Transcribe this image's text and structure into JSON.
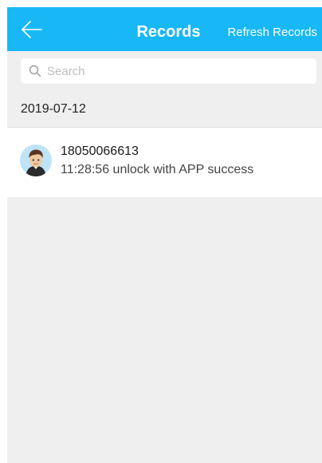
{
  "navbar": {
    "title": "Records",
    "refresh_label": "Refresh Records",
    "bg_color": "#18b8f7",
    "back_icon": "arrow-left-icon"
  },
  "search": {
    "placeholder": "Search",
    "value": "",
    "icon": "search-icon"
  },
  "groups": [
    {
      "date": "2019-07-12",
      "records": [
        {
          "user": "18050066613",
          "time": "11:28:56",
          "action": "unlock with APP success",
          "detail": "11:28:56 unlock with APP success",
          "avatar_icon": "user-avatar-icon"
        }
      ]
    }
  ]
}
